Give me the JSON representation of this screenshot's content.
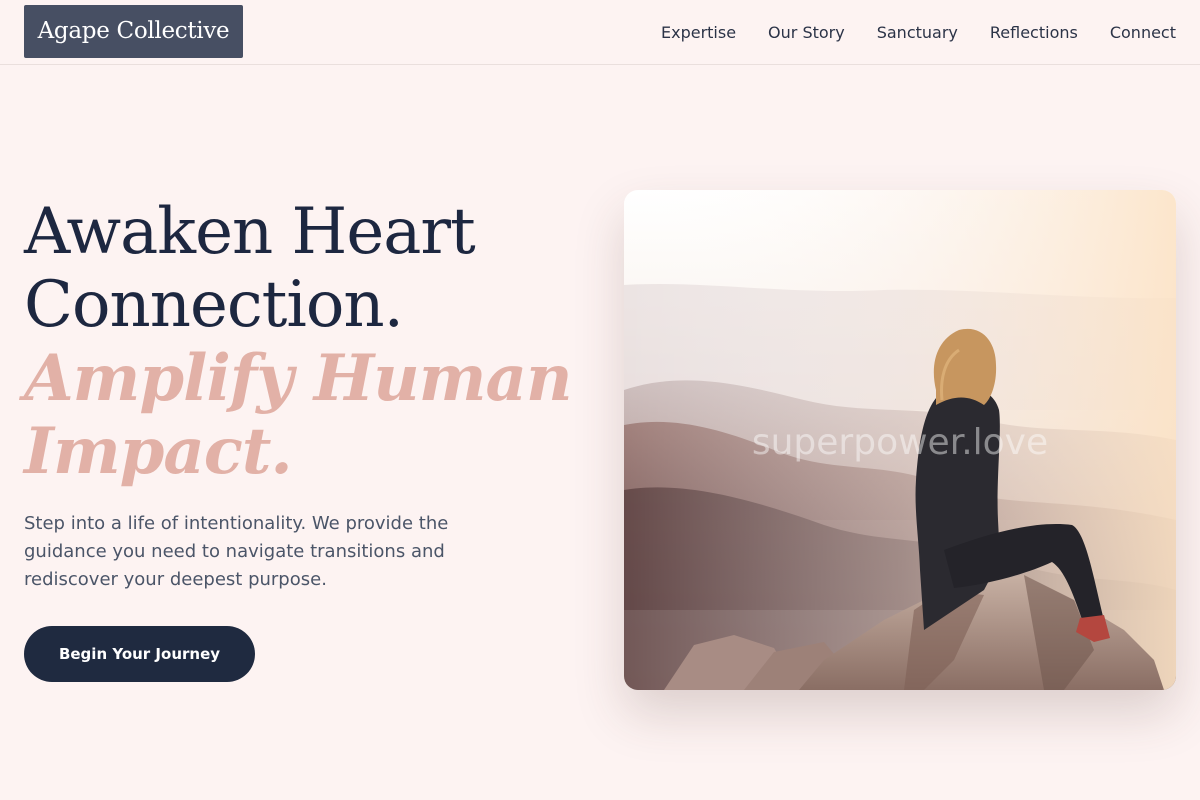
{
  "brand": {
    "logo_text": "Agape Collective"
  },
  "nav": {
    "items": [
      {
        "label": "Expertise"
      },
      {
        "label": "Our Story"
      },
      {
        "label": "Sanctuary"
      },
      {
        "label": "Reflections"
      },
      {
        "label": "Connect"
      }
    ]
  },
  "hero": {
    "headline_line1": "Awaken Heart",
    "headline_line2": "Connection.",
    "headline_line3": "Amplify Human",
    "headline_line4": "Impact.",
    "subtext": "Step into a life of intentionality. We provide the guidance you need to navigate transitions and rediscover your deepest purpose.",
    "cta_label": "Begin Your Journey",
    "image_watermark": "superpower.love"
  },
  "colors": {
    "background": "#fdf3f2",
    "navy": "#1f2a40",
    "accent_pink": "#e2b1a7",
    "logo_bg": "#474f63"
  }
}
